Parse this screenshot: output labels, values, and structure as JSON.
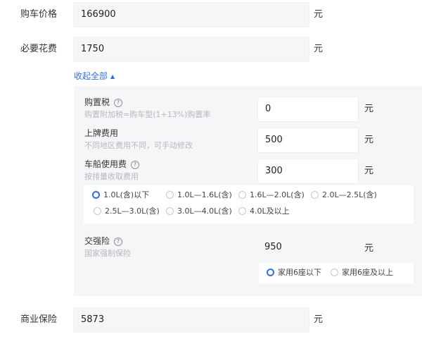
{
  "car_price": {
    "label": "购车价格",
    "value": "166900",
    "unit": "元"
  },
  "required_fees": {
    "label": "必要花费",
    "value": "1750",
    "unit": "元"
  },
  "collapse_toggle": {
    "label": "收起全部",
    "arrow": "▲"
  },
  "purchase_tax": {
    "title": "购置税",
    "help": "?",
    "desc": "购置附加税=购车型(1+13%)购置率",
    "value": "0",
    "unit": "元"
  },
  "plate_fee": {
    "title": "上牌费用",
    "desc": "不同地区费用不同，可手动修改",
    "value": "500",
    "unit": "元"
  },
  "vehicle_tax": {
    "title": "车船使用费",
    "help": "?",
    "desc": "按排量收取费用",
    "value": "300",
    "unit": "元",
    "options": [
      "1.0L(含)以下",
      "1.0L—1.6L(含)",
      "1.6L—2.0L(含)",
      "2.0L—2.5L(含)",
      "2.5L—3.0L(含)",
      "3.0L—4.0L(含)",
      "4.0L及以上"
    ],
    "selected": "1.0L(含)以下"
  },
  "compulsory_insurance": {
    "title": "交强险",
    "help": "?",
    "desc": "国家强制保险",
    "value": "950",
    "unit": "元",
    "options": [
      "家用6座以下",
      "家用6座及以上"
    ],
    "selected": "家用6座以下"
  },
  "commercial_insurance": {
    "label": "商业保险",
    "value": "5873",
    "unit": "元"
  },
  "colors": {
    "accent": "#2f6fe0",
    "panel_bg": "#f5f6f7",
    "field_bg": "#f5f6f7",
    "hint": "#b5b8bd"
  }
}
